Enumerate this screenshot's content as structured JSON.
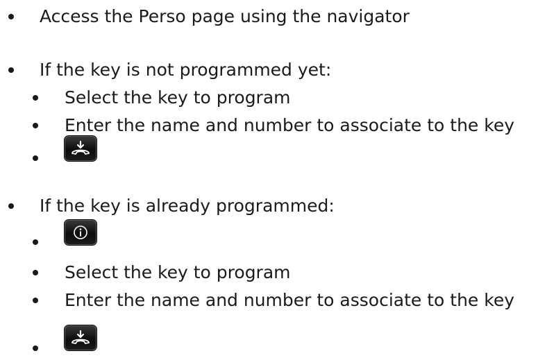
{
  "steps": [
    {
      "text": "Access the Perso page using the navigator",
      "substeps": []
    },
    {
      "text": "If the key is not programmed yet:",
      "substeps": [
        {
          "text": "Select the key to program"
        },
        {
          "text": "Enter the name and number to associate to the key"
        },
        {
          "icon": "off-hook-key-icon"
        }
      ]
    },
    {
      "text": "If the key is already programmed:",
      "substeps": [
        {
          "icon": "info-key-icon"
        },
        {
          "text": "Select the key to program"
        },
        {
          "text": "Enter the name and number to associate to the key"
        },
        {
          "icon": "off-hook-key-icon"
        }
      ]
    }
  ]
}
